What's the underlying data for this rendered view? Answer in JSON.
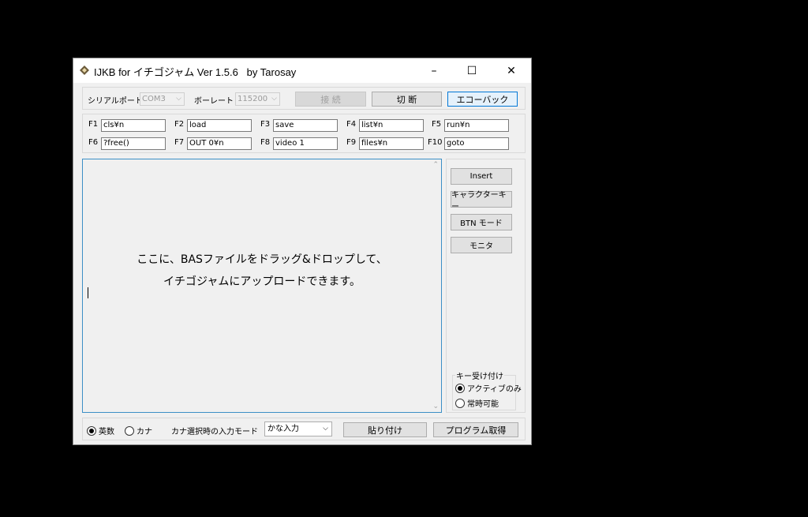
{
  "window": {
    "title": "IJKB for イチゴジャム Ver 1.5.6   by Tarosay",
    "minimize": "–",
    "maximize": "☐",
    "close": "✕"
  },
  "connection": {
    "serial_label": "シリアルポート",
    "serial_value": "COM3",
    "baud_label": "ボーレート",
    "baud_value": "115200",
    "connect": "接 続",
    "disconnect": "切 断",
    "echoback": "エコーバック"
  },
  "function_keys": [
    {
      "label": "F1",
      "value": "cls¥n"
    },
    {
      "label": "F2",
      "value": "load"
    },
    {
      "label": "F3",
      "value": "save"
    },
    {
      "label": "F4",
      "value": "list¥n"
    },
    {
      "label": "F5",
      "value": "run¥n"
    },
    {
      "label": "F6",
      "value": "?free()"
    },
    {
      "label": "F7",
      "value": "OUT 0¥n"
    },
    {
      "label": "F8",
      "value": "video 1"
    },
    {
      "label": "F9",
      "value": "files¥n"
    },
    {
      "label": "F10",
      "value": "goto"
    }
  ],
  "editor": {
    "hint_line1": "ここに、BASファイルをドラッグ&ドロップして、",
    "hint_line2": "イチゴジャムにアップロードできます。"
  },
  "side": {
    "insert": "Insert",
    "character_key": "キャラクターキー",
    "btn_mode": "BTN モード",
    "monitor": "モニタ",
    "key_accept_title": "キー受け付け",
    "active_only": "アクティブのみ",
    "always": "常時可能"
  },
  "bottom": {
    "eisu": "英数",
    "kana": "カナ",
    "kana_mode_label": "カナ選択時の入力モード",
    "kana_mode_value": "かな入力",
    "paste": "貼り付け",
    "get_program": "プログラム取得"
  }
}
